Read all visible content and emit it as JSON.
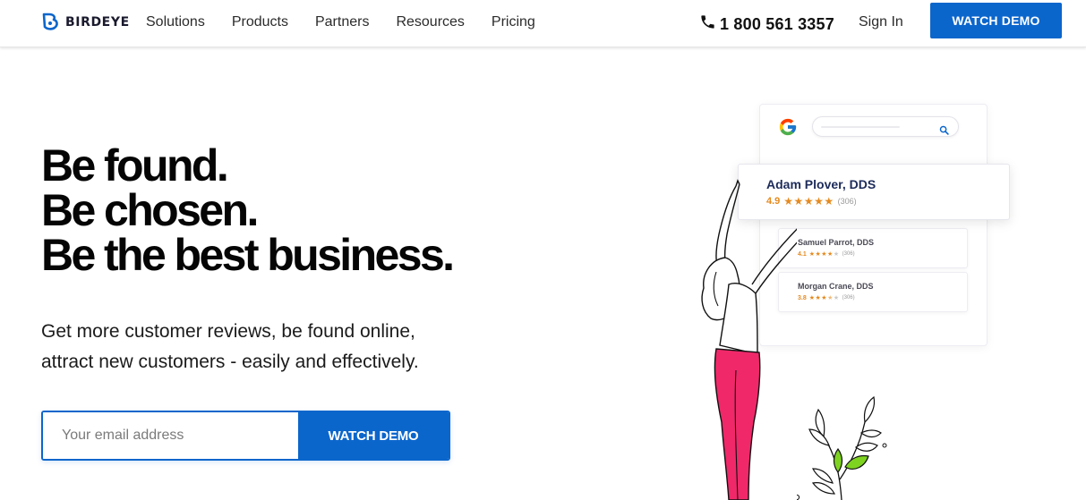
{
  "nav": {
    "brand": "BIRDEYE",
    "items": [
      {
        "label": "Solutions"
      },
      {
        "label": "Products"
      },
      {
        "label": "Partners"
      },
      {
        "label": "Resources"
      },
      {
        "label": "Pricing"
      }
    ],
    "phone": "1 800 561 3357",
    "signin_label": "Sign In",
    "cta_label": "WATCH DEMO"
  },
  "hero": {
    "headline_lines": [
      "Be found.",
      "Be chosen.",
      "Be the best business."
    ],
    "subcopy_lines": [
      "Get more customer reviews, be found online,",
      "attract new customers - easily and effectively."
    ],
    "email_placeholder": "Your email address",
    "email_value": "",
    "cta_label": "WATCH DEMO"
  },
  "illustration": {
    "featured": {
      "name": "Adam Plover, DDS",
      "rating": "4.9",
      "stars_filled": 5,
      "reviews": "(306)"
    },
    "listings": [
      {
        "name": "Samuel Parrot, DDS",
        "rating": "4.1",
        "stars_filled": 4,
        "reviews": "(306)"
      },
      {
        "name": "Morgan Crane, DDS",
        "rating": "3.8",
        "stars_filled": 3.5,
        "reviews": "(306)"
      }
    ]
  },
  "icons": {
    "logo": "birdeye-logo-icon",
    "phone": "phone-icon",
    "google": "google-g-icon",
    "search": "magnifier-icon"
  },
  "colors": {
    "brand_blue": "#0b66cc",
    "rating_orange": "#e58a1f",
    "listing_name_navy": "#1c2b5a",
    "figure_pink": "#f0286a",
    "leaf_green": "#7ed321"
  }
}
